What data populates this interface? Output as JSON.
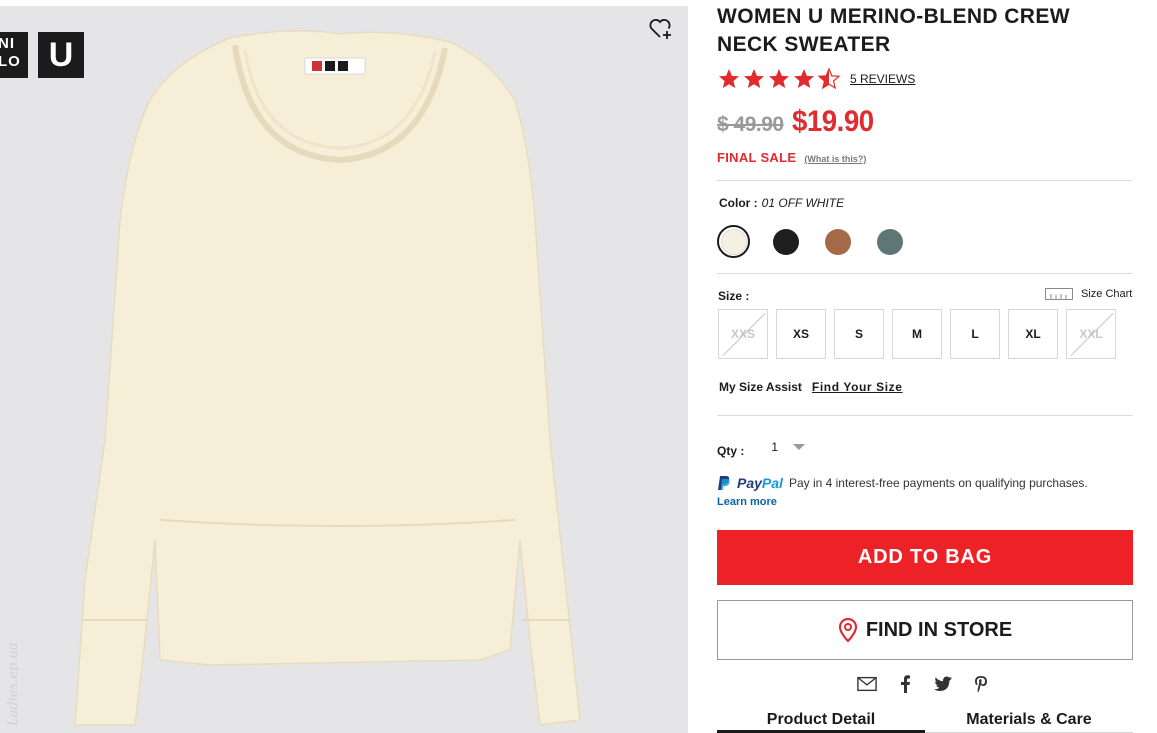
{
  "brand": {
    "logo_left": "NI\nLO",
    "logo_right": "U"
  },
  "watermark": "Ladies.ep.ua",
  "product": {
    "title": "WOMEN U MERINO-BLEND CREW NECK SWEATER",
    "rating": 4.5,
    "reviews_label": "5 REVIEWS",
    "old_price": "$ 49.90",
    "new_price": "$19.90",
    "final_sale_label": "FINAL SALE",
    "what_is_this": "(What is this?)"
  },
  "color": {
    "label": "Color :",
    "value": "01 OFF WHITE",
    "swatches": [
      {
        "name": "off-white",
        "hex": "#f6f0e2",
        "selected": true
      },
      {
        "name": "black",
        "hex": "#1e1e1e",
        "selected": false
      },
      {
        "name": "brown",
        "hex": "#a56a48",
        "selected": false
      },
      {
        "name": "green",
        "hex": "#5f7676",
        "selected": false
      }
    ]
  },
  "size": {
    "label": "Size :",
    "chart_label": "Size Chart",
    "options": [
      {
        "label": "XXS",
        "disabled": true
      },
      {
        "label": "XS",
        "disabled": false
      },
      {
        "label": "S",
        "disabled": false
      },
      {
        "label": "M",
        "disabled": false
      },
      {
        "label": "L",
        "disabled": false
      },
      {
        "label": "XL",
        "disabled": false
      },
      {
        "label": "XXL",
        "disabled": true
      }
    ]
  },
  "mysize": {
    "label": "My Size Assist",
    "link": "Find Your Size"
  },
  "qty": {
    "label": "Qty :",
    "value": "1"
  },
  "paypal": {
    "logo_pay": "Pay",
    "logo_pal": "Pal",
    "text": "Pay in 4 interest-free payments on qualifying purchases.",
    "learn_more": "Learn more"
  },
  "actions": {
    "add_to_bag": "ADD TO BAG",
    "find_in_store": "FIND IN STORE"
  },
  "share_icons": [
    "email-icon",
    "facebook-icon",
    "twitter-icon",
    "pinterest-icon"
  ],
  "tabs": [
    {
      "label": "Product Detail",
      "active": true
    },
    {
      "label": "Materials & Care",
      "active": false
    }
  ],
  "colors": {
    "accent_red": "#ed2226",
    "price_red": "#e22b2f",
    "sweater": "#f7eed8"
  }
}
